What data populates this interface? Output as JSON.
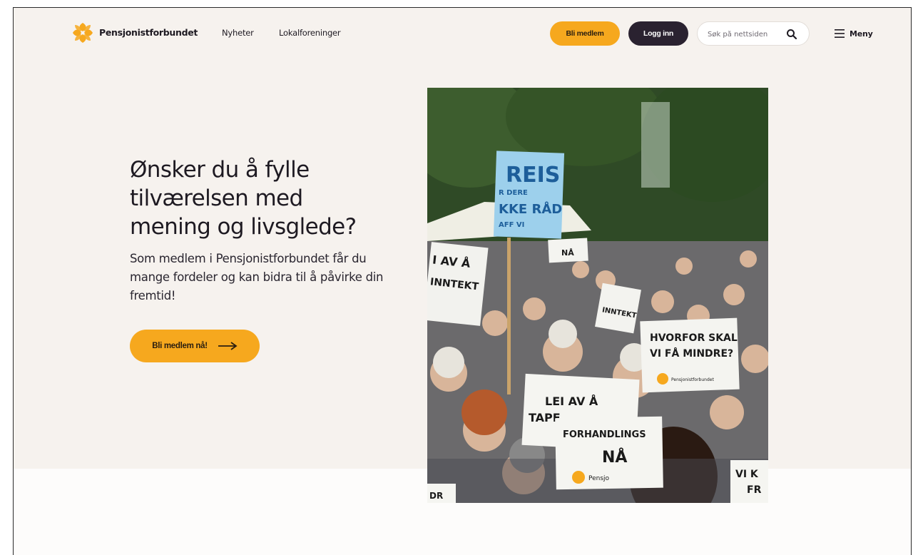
{
  "header": {
    "brand": "Pensjonistforbundet",
    "nav": [
      "Nyheter",
      "Lokalforeninger"
    ],
    "member_button": "Bli medlem",
    "login_button": "Logg inn",
    "search_placeholder": "Søk på nettsiden",
    "menu_label": "Meny"
  },
  "hero": {
    "headline": "Ønsker du å fylle tilværelsen med mening og livsglede?",
    "subtext": "Som medlem i Pensjonistforbundet får du mange fordeler og kan bidra til å påvirke din fremtid!",
    "cta_label": "Bli medlem nå!"
  },
  "photo": {
    "signs": [
      "REIS",
      "R DERE",
      "KKE RÅD",
      "AFF VI",
      "NÅ",
      "I AV Å",
      "INNTEKT",
      "INNTEKT",
      "HVORFOR SKAL",
      "VI FÅ MINDRE?",
      "Pensjonistforbundet",
      "LEI AV Å",
      "TAPE",
      "FORHANDLINGS",
      "NÅ",
      "Pensjo",
      "VI K",
      "FR",
      "DR"
    ]
  },
  "colors": {
    "accent": "#f6a81e",
    "dark": "#2a2230",
    "hero_bg": "#f6f2ee"
  }
}
